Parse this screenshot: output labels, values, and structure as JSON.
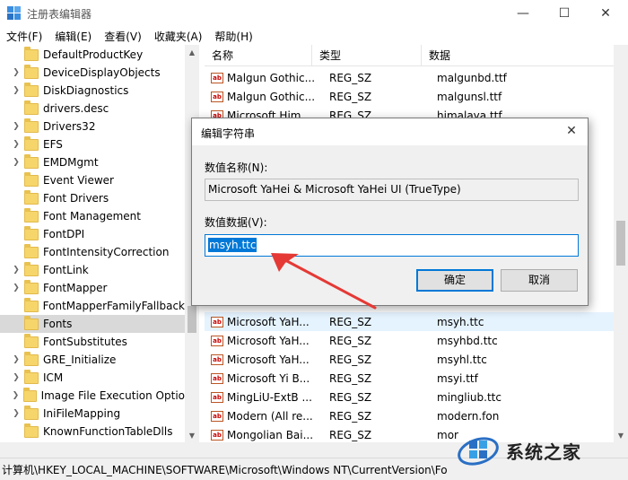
{
  "window": {
    "title": "注册表编辑器"
  },
  "menu": [
    "文件(F)",
    "编辑(E)",
    "查看(V)",
    "收藏夹(A)",
    "帮助(H)"
  ],
  "tree_items": [
    {
      "label": "DefaultProductKey",
      "arrow": false
    },
    {
      "label": "DeviceDisplayObjects",
      "arrow": true
    },
    {
      "label": "DiskDiagnostics",
      "arrow": true
    },
    {
      "label": "drivers.desc",
      "arrow": false
    },
    {
      "label": "Drivers32",
      "arrow": true
    },
    {
      "label": "EFS",
      "arrow": true
    },
    {
      "label": "EMDMgmt",
      "arrow": true
    },
    {
      "label": "Event Viewer",
      "arrow": false
    },
    {
      "label": "Font Drivers",
      "arrow": false
    },
    {
      "label": "Font Management",
      "arrow": false
    },
    {
      "label": "FontDPI",
      "arrow": false
    },
    {
      "label": "FontIntensityCorrection",
      "arrow": false
    },
    {
      "label": "FontLink",
      "arrow": true
    },
    {
      "label": "FontMapper",
      "arrow": true
    },
    {
      "label": "FontMapperFamilyFallback",
      "arrow": false
    },
    {
      "label": "Fonts",
      "arrow": false,
      "selected": true
    },
    {
      "label": "FontSubstitutes",
      "arrow": false
    },
    {
      "label": "GRE_Initialize",
      "arrow": true
    },
    {
      "label": "ICM",
      "arrow": true
    },
    {
      "label": "Image File Execution Optio",
      "arrow": true
    },
    {
      "label": "IniFileMapping",
      "arrow": true
    },
    {
      "label": "KnownFunctionTableDlls",
      "arrow": false
    }
  ],
  "list": {
    "columns": [
      "名称",
      "类型",
      "数据"
    ],
    "rows_top": [
      {
        "name": "Malgun Gothic...",
        "type": "REG_SZ",
        "data": "malgunbd.ttf"
      },
      {
        "name": "Malgun Gothic...",
        "type": "REG_SZ",
        "data": "malgunsl.ttf"
      },
      {
        "name": "Microsoft Him...",
        "type": "REG_SZ",
        "data": "himalaya.ttf"
      }
    ],
    "rows_bottom": [
      {
        "name": "Microsoft YaH...",
        "type": "REG_SZ",
        "data": "msyh.ttc",
        "highlight": true
      },
      {
        "name": "Microsoft YaH...",
        "type": "REG_SZ",
        "data": "msyhbd.ttc"
      },
      {
        "name": "Microsoft YaH...",
        "type": "REG_SZ",
        "data": "msyhl.ttc"
      },
      {
        "name": "Microsoft Yi B...",
        "type": "REG_SZ",
        "data": "msyi.ttf"
      },
      {
        "name": "MingLiU-ExtB ...",
        "type": "REG_SZ",
        "data": "mingliub.ttc"
      },
      {
        "name": "Modern (All re...",
        "type": "REG_SZ",
        "data": "modern.fon"
      },
      {
        "name": "Mongolian Bai...",
        "type": "REG_SZ",
        "data": "mor"
      }
    ],
    "icon_text": "ab"
  },
  "dialog": {
    "title": "编辑字符串",
    "name_label": "数值名称(N):",
    "name_value": "Microsoft YaHei & Microsoft YaHei UI (TrueType)",
    "data_label": "数值数据(V):",
    "data_value": "msyh.ttc",
    "ok_label": "确定",
    "cancel_label": "取消"
  },
  "status": {
    "path": "计算机\\HKEY_LOCAL_MACHINE\\SOFTWARE\\Microsoft\\Windows NT\\CurrentVersion\\Fo"
  },
  "watermark": {
    "text": "系统之家"
  },
  "colors": {
    "accent": "#0078d7",
    "arrow": "#e53935",
    "selection": "#d9d9d9",
    "row_highlight": "#e5f3ff"
  }
}
